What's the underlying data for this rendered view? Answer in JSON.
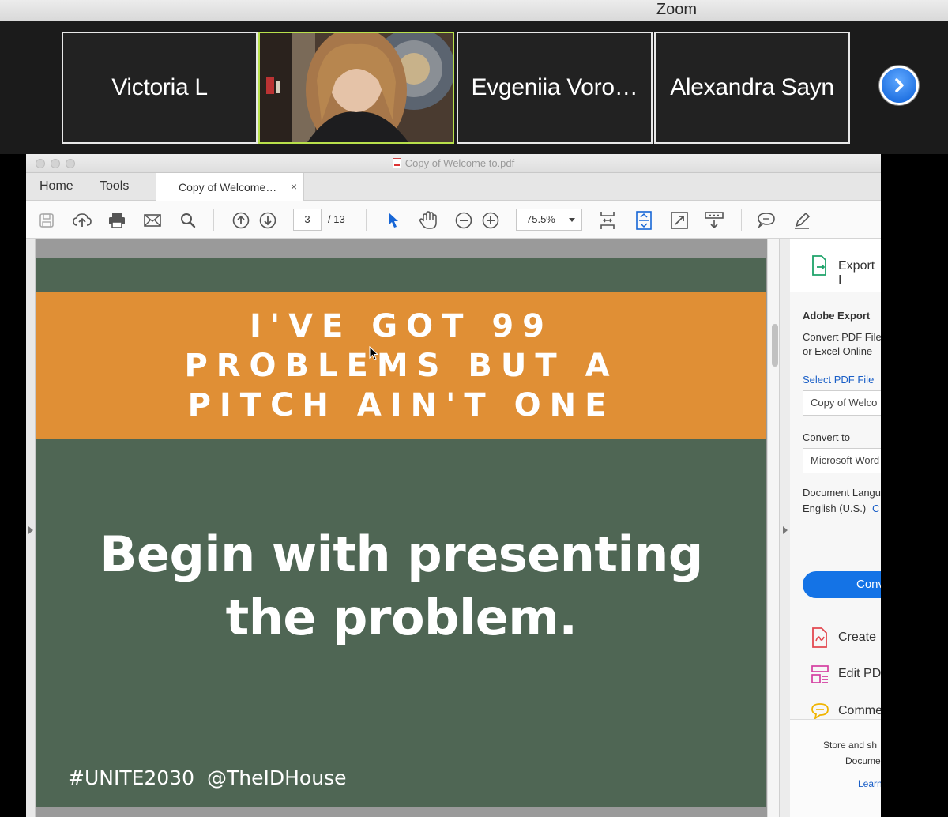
{
  "zoom": {
    "title": "Zoom",
    "participants": [
      {
        "name": "Victoria L",
        "video": false
      },
      {
        "name": "",
        "video": true
      },
      {
        "name": "Evgeniia Voro…",
        "video": false
      },
      {
        "name": "Alexandra Sayn",
        "video": false
      }
    ],
    "next_icon": "chevron-right-circle-icon",
    "active_speaker_color": "#b8e04b"
  },
  "acrobat": {
    "window_title": "Copy of Welcome to.pdf",
    "nav_tabs": [
      "Home",
      "Tools"
    ],
    "doc_tab": {
      "label": "Copy of Welcome…",
      "close": "×"
    },
    "toolbar": {
      "page_current": "3",
      "page_total": "/ 13",
      "zoom": "75.5%"
    }
  },
  "slide": {
    "banner": "I'VE GOT 99 PROBLEMS BUT A PITCH AIN'T ONE",
    "headline_line1": "Begin with presenting",
    "headline_line2": "the problem.",
    "hashtag": "#UNITE2030",
    "handle": "@TheIDHouse",
    "colors": {
      "background": "#4f6654",
      "banner": "#e08f35",
      "text": "#ffffff"
    }
  },
  "tools_pane": {
    "export_label": "Export I",
    "section_title": "Adobe Export",
    "desc_line1": "Convert PDF File",
    "desc_line2": "or Excel Online",
    "select_link": "Select PDF File",
    "file_field": "Copy of Welco",
    "convert_to_label": "Convert to",
    "convert_to_value": "Microsoft Word",
    "doc_lang_label": "Document Langu",
    "doc_lang_value": "English (U.S.)",
    "doc_lang_change": "C",
    "convert_button": "Conv",
    "tools": [
      {
        "label": "Create I",
        "icon": "create-pdf-icon"
      },
      {
        "label": "Edit PDI",
        "icon": "edit-pdf-icon"
      },
      {
        "label": "Comme",
        "icon": "comment-icon"
      }
    ],
    "footer_line1": "Store and sh",
    "footer_line2": "Docume",
    "footer_link": "Learn",
    "accent_color": "#1473e6"
  }
}
